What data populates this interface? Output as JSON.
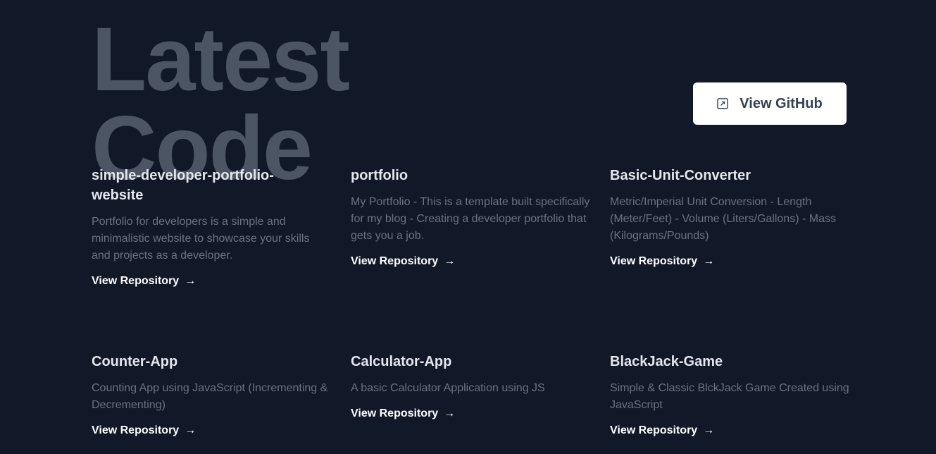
{
  "hero": {
    "line1": "Latest",
    "line2": "Code"
  },
  "github_button": {
    "label": "View GitHub",
    "icon": "external-link-icon"
  },
  "projects": [
    {
      "title": "simple-developer-portfolio-website",
      "description": "Portfolio for developers is a simple and minimalistic website to showcase your skills and projects as a developer.",
      "link_label": "View Repository",
      "arrow": "→"
    },
    {
      "title": "portfolio",
      "description": "My Portfolio - This is a template built specifically for my blog - Creating a developer portfolio that gets you a job.",
      "link_label": "View Repository",
      "arrow": "→"
    },
    {
      "title": "Basic-Unit-Converter",
      "description": "Metric/Imperial Unit Conversion - Length (Meter/Feet) - Volume (Liters/Gallons) - Mass (Kilograms/Pounds)",
      "link_label": "View Repository",
      "arrow": "→"
    },
    {
      "title": "Counter-App",
      "description": "Counting App using JavaScript (Incrementing & Decrementing)",
      "link_label": "View Repository",
      "arrow": "→"
    },
    {
      "title": "Calculator-App",
      "description": "A basic Calculator Application using JS",
      "link_label": "View Repository",
      "arrow": "→"
    },
    {
      "title": "BlackJack-Game",
      "description": "Simple & Classic BlckJack Game Created using JavaScript",
      "link_label": "View Repository",
      "arrow": "→"
    }
  ],
  "colors": {
    "background": "#111827",
    "hero_text": "#4b5563",
    "title_text": "#e5e7eb",
    "description_text": "#6b7280",
    "link_text": "#ffffff",
    "button_bg": "#ffffff"
  }
}
